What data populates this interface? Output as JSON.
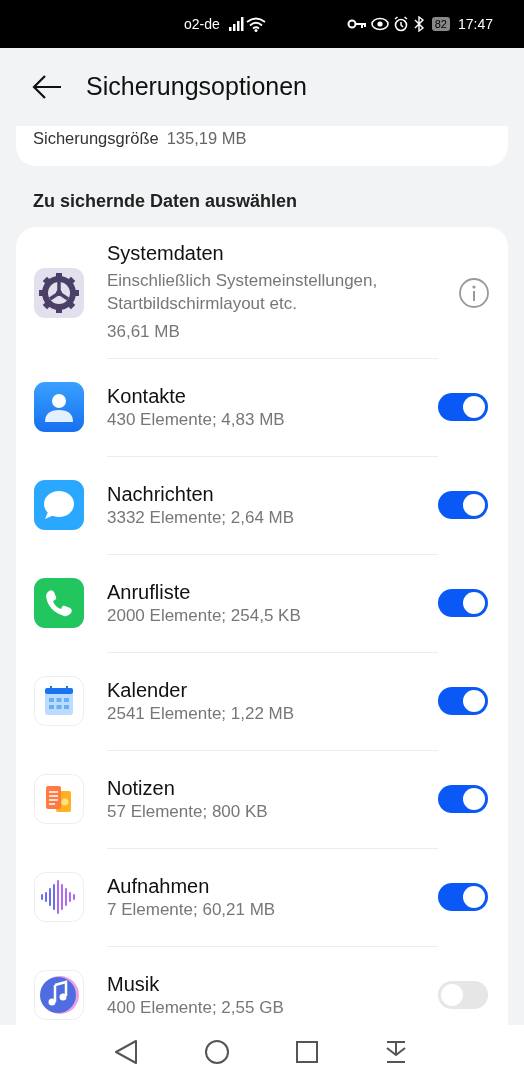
{
  "status_bar": {
    "carrier": "o2-de",
    "battery": "82",
    "time": "17:47"
  },
  "header": {
    "title": "Sicherungsoptionen"
  },
  "summary": {
    "label": "Sicherungsgröße",
    "value": "135,19 MB"
  },
  "section_title": "Zu sichernde Daten auswählen",
  "items": [
    {
      "kind": "info",
      "title": "Systemdaten",
      "description": "Einschließlich Systemeinstellungen, Startbildschirmlayout etc.",
      "size": "36,61 MB"
    },
    {
      "kind": "toggle",
      "title": "Kontakte",
      "size": "430 Elemente; 4,83 MB",
      "on": true
    },
    {
      "kind": "toggle",
      "title": "Nachrichten",
      "size": "3332 Elemente; 2,64 MB",
      "on": true
    },
    {
      "kind": "toggle",
      "title": "Anrufliste",
      "size": "2000 Elemente; 254,5 KB",
      "on": true
    },
    {
      "kind": "toggle",
      "title": "Kalender",
      "size": "2541 Elemente; 1,22 MB",
      "on": true
    },
    {
      "kind": "toggle",
      "title": "Notizen",
      "size": "57 Elemente; 800 KB",
      "on": true
    },
    {
      "kind": "toggle",
      "title": "Aufnahmen",
      "size": "7 Elemente; 60,21 MB",
      "on": true
    },
    {
      "kind": "toggle",
      "title": "Musik",
      "size": "400 Elemente; 2,55 GB",
      "on": false
    }
  ]
}
